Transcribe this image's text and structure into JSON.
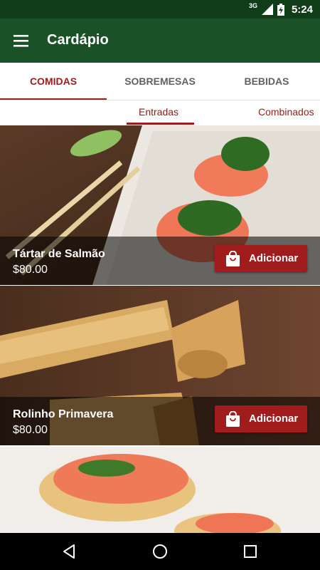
{
  "status_bar": {
    "network": "3G",
    "time": "5:24",
    "icons": [
      "network-3g-icon",
      "signal-icon",
      "battery-icon"
    ]
  },
  "app_bar": {
    "title": "Cardápio",
    "menu_icon": "hamburger-menu-icon"
  },
  "tabs": [
    {
      "label": "COMIDAS",
      "active": true
    },
    {
      "label": "SOBREMESAS",
      "active": false
    },
    {
      "label": "BEBIDAS",
      "active": false
    }
  ],
  "subtabs": [
    {
      "label": "Entradas",
      "active": true
    },
    {
      "label": "Combinados",
      "active": false
    }
  ],
  "menu_items": [
    {
      "name": "Tártar de Salmão",
      "price": "$80.00",
      "button_label": "Adicionar",
      "button_icon": "shopping-bag-icon"
    },
    {
      "name": "Rolinho Primavera",
      "price": "$80.00",
      "button_label": "Adicionar",
      "button_icon": "shopping-bag-icon"
    }
  ],
  "nav_bar": {
    "icons": [
      "back-triangle-icon",
      "home-circle-icon",
      "recents-square-icon"
    ]
  },
  "colors": {
    "status_bar": "#0f3d17",
    "app_bar": "#1b5127",
    "accent": "#9b1c1c",
    "add_button": "#a11d1d"
  }
}
